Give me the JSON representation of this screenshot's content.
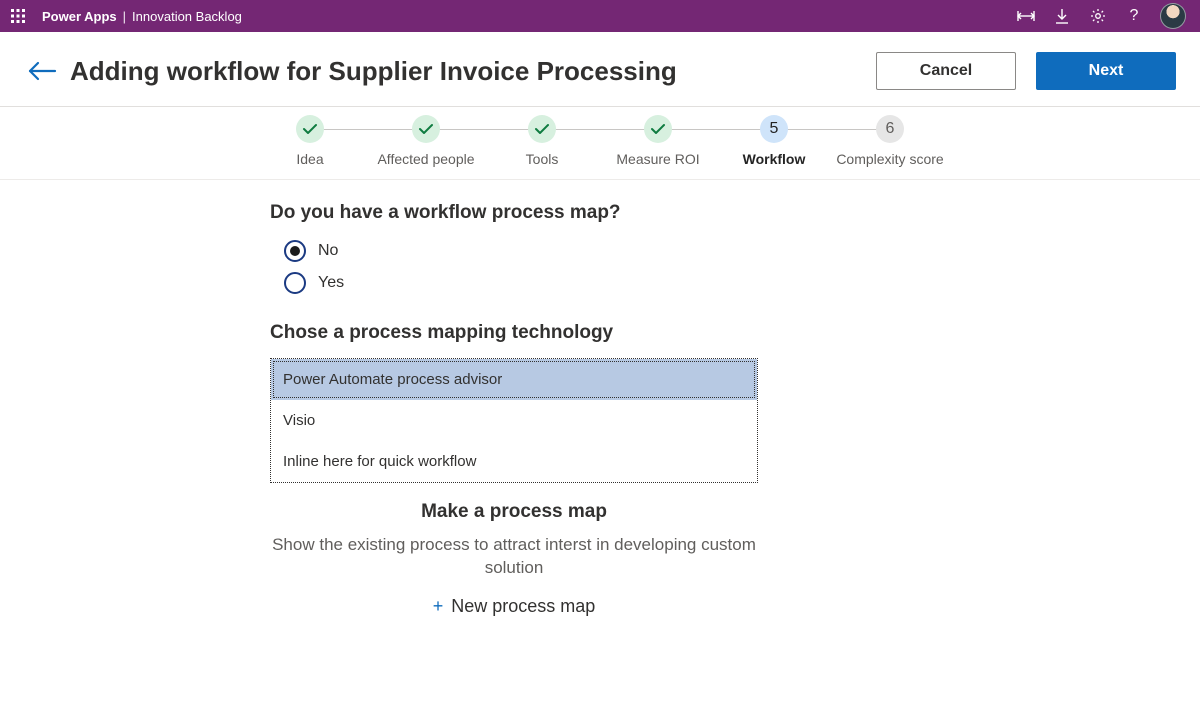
{
  "topbar": {
    "app_name": "Power Apps",
    "app_context": "Innovation Backlog"
  },
  "header": {
    "title": "Adding workflow for Supplier Invoice Processing",
    "cancel_label": "Cancel",
    "next_label": "Next"
  },
  "stepper": {
    "steps": [
      {
        "label": "Idea",
        "state": "done"
      },
      {
        "label": "Affected people",
        "state": "done"
      },
      {
        "label": "Tools",
        "state": "done"
      },
      {
        "label": "Measure ROI",
        "state": "done"
      },
      {
        "label": "Workflow",
        "state": "current",
        "number": "5"
      },
      {
        "label": "Complexity score",
        "state": "future",
        "number": "6"
      }
    ]
  },
  "form": {
    "question1": "Do you have a workflow process map?",
    "radio_options": [
      "No",
      "Yes"
    ],
    "radio_selected_index": 0,
    "question2": "Chose a process mapping technology",
    "tech_options": [
      "Power Automate process advisor",
      "Visio",
      "Inline here for quick workflow"
    ],
    "tech_selected_index": 0,
    "make_map_title": "Make a process map",
    "make_map_desc": "Show the existing process to attract interst in developing custom solution",
    "new_map_label": "New process map"
  }
}
